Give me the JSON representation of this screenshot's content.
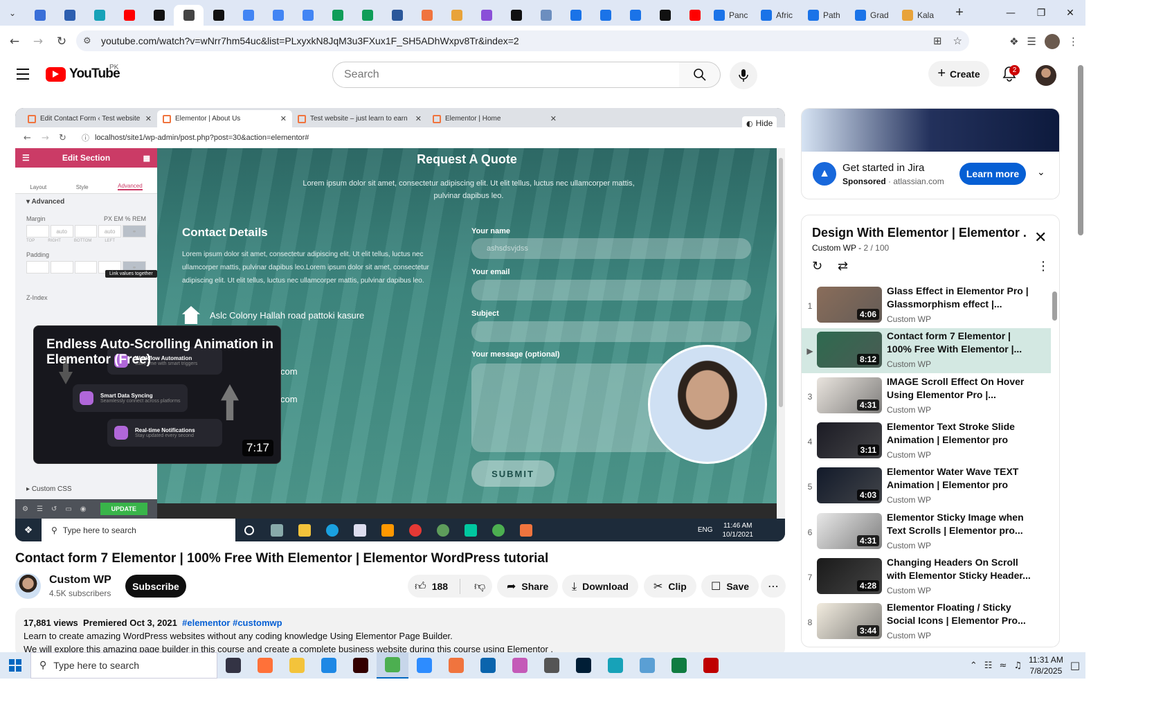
{
  "browser": {
    "tabs": [
      {
        "label": "",
        "icon": "shield-icon",
        "color": "#3a6fd8"
      },
      {
        "label": "",
        "icon": "wordpress-icon",
        "color": "#2d5fb0"
      },
      {
        "label": "",
        "icon": "diamond-icon",
        "color": "#17a2b8"
      },
      {
        "label": "",
        "icon": "youtube-icon",
        "color": "#ff0000"
      },
      {
        "label": "",
        "icon": "threads-icon",
        "color": "#111111"
      },
      {
        "label": "",
        "icon": "speaker-icon",
        "color": "#444444",
        "active": true
      },
      {
        "label": "",
        "icon": "lightning-icon",
        "color": "#111111"
      },
      {
        "label": "",
        "icon": "docs-icon",
        "color": "#4285f4"
      },
      {
        "label": "",
        "icon": "docs-icon",
        "color": "#4285f4"
      },
      {
        "label": "",
        "icon": "docs-icon",
        "color": "#4285f4"
      },
      {
        "label": "",
        "icon": "sheets-icon",
        "color": "#0f9d58"
      },
      {
        "label": "",
        "icon": "sheets-icon",
        "color": "#0f9d58"
      },
      {
        "label": "",
        "icon": "word-icon",
        "color": "#2b579a"
      },
      {
        "label": "",
        "icon": "elementor-icon",
        "color": "#f0743e"
      },
      {
        "label": "",
        "icon": "bird-icon",
        "color": "#e8a33a"
      },
      {
        "label": "",
        "icon": "code-icon",
        "color": "#8a4fd8"
      },
      {
        "label": "",
        "icon": "x-icon",
        "color": "#111111"
      },
      {
        "label": "",
        "icon": "grid-icon",
        "color": "#6c8ebf"
      },
      {
        "label": "",
        "icon": "docs-icon",
        "color": "#1a73e8"
      },
      {
        "label": "",
        "icon": "docs-icon",
        "color": "#1a73e8"
      },
      {
        "label": "",
        "icon": "docs-icon",
        "color": "#1a73e8"
      },
      {
        "label": "",
        "icon": "medium-icon",
        "color": "#111111"
      },
      {
        "label": "",
        "icon": "youtube-icon",
        "color": "#ff0000"
      }
    ],
    "wide_tabs": [
      {
        "label": "Panc",
        "color": "#1a73e8"
      },
      {
        "label": "Afric",
        "color": "#1a73e8"
      },
      {
        "label": "Path",
        "color": "#1a73e8"
      },
      {
        "label": "Grad",
        "color": "#1a73e8"
      },
      {
        "label": "Kala",
        "color": "#e8a33a"
      }
    ],
    "url": "youtube.com/watch?v=wNrr7hm54uc&list=PLxyxkN8JqM3u3FXux1F_SH5ADhWxpv8Tr&index=2"
  },
  "youtube": {
    "logo_text": "YouTube",
    "country_code": "PK",
    "search_placeholder": "Search",
    "create_label": "Create",
    "notification_count": "2"
  },
  "player": {
    "inner_tabs": [
      {
        "label": "Edit Contact Form ‹ Test website"
      },
      {
        "label": "Elementor | About Us",
        "active": true
      },
      {
        "label": "Test website – just learn to earn"
      },
      {
        "label": "Elementor | Home"
      }
    ],
    "hide_label": "Hide",
    "inner_url": "localhost/site1/wp-admin/post.php?post=30&action=elementor#",
    "editor": {
      "title": "Edit Section",
      "tabs": [
        "Layout",
        "Style",
        "Advanced"
      ],
      "section": "Advanced",
      "margin_label": "Margin",
      "units": "PX  EM  %  REM",
      "margin_values": [
        "",
        "auto",
        "",
        "auto"
      ],
      "box_captions": [
        "TOP",
        "RIGHT",
        "BOTTOM",
        "LEFT"
      ],
      "padding_label": "Padding",
      "tooltip": "Link values together",
      "zindex_label": "Z-Index",
      "custom_css": "Custom CSS",
      "update_label": "UPDATE"
    },
    "page": {
      "title": "Request A Quote",
      "subtitle": "Lorem ipsum dolor sit amet, consectetur adipiscing elit. Ut elit tellus, luctus nec ullamcorper mattis, pulvinar dapibus leo.",
      "contact_title": "Contact Details",
      "contact_text": "Lorem ipsum dolor sit amet, consectetur adipiscing elit. Ut elit tellus, luctus nec ullamcorper mattis, pulvinar dapibus leo.Lorem ipsum dolor sit amet, consectetur adipiscing elit. Ut elit tellus, luctus nec ullamcorper mattis, pulvinar dapibus leo.",
      "address": "Aslc Colony Hallah road pattoki kasure",
      "email_1": "com",
      "email_2": "com",
      "name_label": "Your name",
      "name_value": "ashsdsvjdss",
      "email_label": "Your email",
      "subject_label": "Subject",
      "message_label": "Your message (optional)",
      "submit_label": "SUBMIT"
    },
    "inner_taskbar": {
      "search": "Type here to search",
      "lang": "ENG",
      "time": "11:46 AM",
      "date": "10/1/2021"
    },
    "hover_card": {
      "title": "Endless Auto-Scrolling Animation in Elementor (Free)",
      "items": [
        {
          "title": "Workflow Automation",
          "sub": "Save time with smart triggers"
        },
        {
          "title": "Smart Data Syncing",
          "sub": "Seamlessly connect across platforms"
        },
        {
          "title": "Real-time Notifications",
          "sub": "Stay updated every second"
        }
      ],
      "duration": "7:17"
    }
  },
  "video": {
    "title": "Contact form 7 Elementor | 100% Free With Elementor | Elementor WordPress tutorial",
    "channel": "Custom WP",
    "subscribers": "4.5K subscribers",
    "subscribe_label": "Subscribe",
    "likes": "188",
    "share_label": "Share",
    "download_label": "Download",
    "clip_label": "Clip",
    "save_label": "Save",
    "views": "17,881 views",
    "premiered": "Premiered Oct 3, 2021",
    "tags": "#elementor #customwp",
    "desc_line1": "Learn to create amazing WordPress websites without any coding knowledge Using Elementor Page Builder.",
    "desc_line2": "We will explore this amazing page builder in this course and create a complete business website during this course using Elementor ."
  },
  "ad": {
    "headline": "Get started in Jira",
    "sponsored": "Sponsored",
    "domain": "atlassian.com",
    "cta": "Learn more"
  },
  "playlist": {
    "title": "Design With Elementor | Elementor ...",
    "channel": "Custom WP",
    "position": "2 / 100",
    "items": [
      {
        "num": "1",
        "title": "Glass Effect in Elementor Pro | Glassmorphism effect |...",
        "channel": "Custom WP",
        "duration": "4:06",
        "color": "#8a6d5a"
      },
      {
        "num": "▶",
        "title": "Contact form 7 Elementor | 100% Free With Elementor |...",
        "channel": "Custom WP",
        "duration": "8:12",
        "color": "#2e6a4f",
        "current": true
      },
      {
        "num": "3",
        "title": "IMAGE Scroll Effect On Hover Using Elementor Pro |...",
        "channel": "Custom WP",
        "duration": "4:31",
        "color": "#e9e4de"
      },
      {
        "num": "4",
        "title": "Elementor Text Stroke Slide Animation | Elementor pro Tip...",
        "channel": "Custom WP",
        "duration": "3:11",
        "color": "#1b1b24"
      },
      {
        "num": "5",
        "title": "Elementor Water Wave TEXT Animation | Elementor pro Tip...",
        "channel": "Custom WP",
        "duration": "4:03",
        "color": "#121a2a"
      },
      {
        "num": "6",
        "title": "Elementor Sticky Image when Text Scrolls | Elementor pro...",
        "channel": "Custom WP",
        "duration": "4:31",
        "color": "#e8e8e8"
      },
      {
        "num": "7",
        "title": "Changing Headers On Scroll with Elementor Sticky Header...",
        "channel": "Custom WP",
        "duration": "4:28",
        "color": "#1a1a1a"
      },
      {
        "num": "8",
        "title": "Elementor Floating / Sticky Social Icons | Elementor Pro...",
        "channel": "Custom WP",
        "duration": "3:44",
        "color": "#f2ecdf"
      }
    ]
  },
  "taskbar": {
    "search": "Type here to search",
    "time": "11:31 AM",
    "date": "7/8/2025",
    "apps": [
      {
        "icon": "task-view-icon",
        "color": "#334"
      },
      {
        "icon": "firefox-icon",
        "color": "#ff7139"
      },
      {
        "icon": "file-explorer-icon",
        "color": "#f3c33b"
      },
      {
        "icon": "vscode-icon",
        "color": "#1e88e5"
      },
      {
        "icon": "illustrator-icon",
        "color": "#330000"
      },
      {
        "icon": "chrome-icon",
        "color": "#4caf50",
        "active": true
      },
      {
        "icon": "zoom-icon",
        "color": "#2d8cff"
      },
      {
        "icon": "elementor-icon",
        "color": "#f0743e"
      },
      {
        "icon": "outlook-icon",
        "color": "#0a64ad"
      },
      {
        "icon": "paint-icon",
        "color": "#c45ab8"
      },
      {
        "icon": "pen-icon",
        "color": "#555555"
      },
      {
        "icon": "photoshop-icon",
        "color": "#001e36"
      },
      {
        "icon": "diamond-icon",
        "color": "#17a2b8"
      },
      {
        "icon": "notepad-icon",
        "color": "#5a9fd4"
      },
      {
        "icon": "excel-icon",
        "color": "#107c41"
      },
      {
        "icon": "filezilla-icon",
        "color": "#bf0000"
      }
    ]
  }
}
